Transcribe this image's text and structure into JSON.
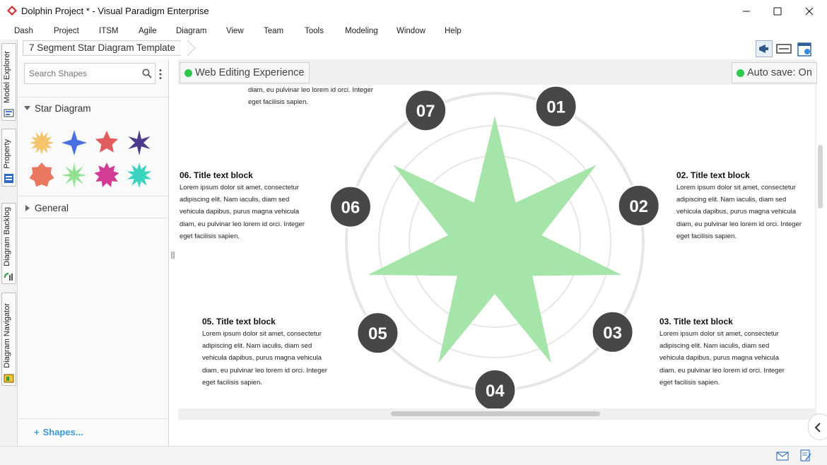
{
  "window": {
    "title": "Dolphin Project * - Visual Paradigm Enterprise",
    "controls": [
      "minimize",
      "maximize",
      "close"
    ]
  },
  "menu": [
    "Dash",
    "Project",
    "ITSM",
    "Agile",
    "Diagram",
    "View",
    "Team",
    "Tools",
    "Modeling",
    "Window",
    "Help"
  ],
  "side_tabs": [
    {
      "label": "Model Explorer",
      "icon": "model-explorer-icon"
    },
    {
      "label": "Property",
      "icon": "property-icon"
    },
    {
      "label": "Diagram Backlog",
      "icon": "diagram-backlog-icon"
    },
    {
      "label": "Diagram Navigator",
      "icon": "diagram-navigator-icon"
    }
  ],
  "breadcrumb": "7 Segment Star Diagram Template",
  "left_panel": {
    "search_placeholder": "Search Shapes",
    "section_star": "Star Diagram",
    "section_general": "General",
    "shapes_link": "Shapes...",
    "shape_colors": [
      "#f6c46a",
      "#4a6fe0",
      "#e25d5d",
      "#4b3b8c",
      "#e9785f",
      "#8fe08f",
      "#d13d94",
      "#39d3c1"
    ]
  },
  "canvas": {
    "web_editing": "Web Editing Experience",
    "auto_save": "Auto save: On",
    "star_color": "#a6e5a9",
    "node_color": "#474747",
    "nodes": [
      "07",
      "01",
      "02",
      "03",
      "04",
      "05",
      "06"
    ],
    "blocks": {
      "top_partial_1": "diam, eu pulvinar leo lorem id orci. Integer",
      "top_partial_2": "eget facilisis sapien.",
      "b06": {
        "title": "06. Title text block",
        "lines": [
          "Lorem ipsum dolor sit amet, consectetur",
          "adipiscing elit. Nam iaculis, diam sed",
          "vehicula dapibus, purus magna vehicula",
          "diam, eu pulvinar leo lorem id orci. Integer",
          "eget facilisis sapien."
        ]
      },
      "b02": {
        "title": "02. Title text block",
        "lines": [
          "Lorem ipsum dolor sit amet, consectetur",
          "adipiscing elit. Nam iaculis, diam sed",
          "vehicula dapibus, purus magna vehicula",
          "diam, eu pulvinar leo lorem id orci. Integer",
          "eget facilisis sapien."
        ]
      },
      "b05": {
        "title": "05. Title text block",
        "lines": [
          "Lorem ipsum dolor sit amet, consectetur",
          "adipiscing elit. Nam iaculis, diam sed",
          "vehicula dapibus, purus magna vehicula",
          "diam, eu pulvinar leo lorem id orci. Integer",
          "eget facilisis sapien."
        ]
      },
      "b03": {
        "title": "03. Title text block",
        "lines": [
          "Lorem ipsum dolor sit amet, consectetur",
          "adipiscing elit. Nam iaculis, diam sed",
          "vehicula dapibus, purus magna vehicula",
          "diam, eu pulvinar leo lorem id orci. Integer",
          "eget facilisis sapien."
        ]
      }
    }
  },
  "toolbar_icons": [
    "announcement-icon",
    "fit-to-window-icon",
    "diagram-settings-icon"
  ],
  "status_icons": [
    "mail-icon",
    "edit-note-icon"
  ]
}
